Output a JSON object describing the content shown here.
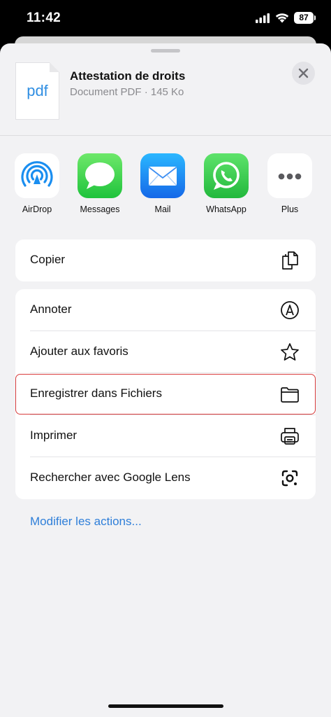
{
  "status_bar": {
    "time": "11:42",
    "battery": "87"
  },
  "document": {
    "thumb_label": "pdf",
    "title": "Attestation de droits",
    "subtitle": "Document PDF · 145 Ko"
  },
  "apps": [
    {
      "label": "AirDrop",
      "icon": "airdrop-icon"
    },
    {
      "label": "Messages",
      "icon": "messages-icon"
    },
    {
      "label": "Mail",
      "icon": "mail-icon"
    },
    {
      "label": "WhatsApp",
      "icon": "whatsapp-icon"
    },
    {
      "label": "Plus",
      "icon": "more-icon"
    }
  ],
  "actions_group1": [
    {
      "label": "Copier",
      "icon": "copy-icon"
    }
  ],
  "actions_group2": [
    {
      "label": "Annoter",
      "icon": "markup-icon"
    },
    {
      "label": "Ajouter aux favoris",
      "icon": "star-icon"
    },
    {
      "label": "Enregistrer dans Fichiers",
      "icon": "folder-icon"
    },
    {
      "label": "Imprimer",
      "icon": "printer-icon"
    },
    {
      "label": "Rechercher avec Google Lens",
      "icon": "google-lens-icon"
    }
  ],
  "edit_actions_label": "Modifier les actions...",
  "colors": {
    "accent": "#2f7fd9",
    "highlight": "#d93d3d",
    "sheet_bg": "#f2f2f4"
  }
}
